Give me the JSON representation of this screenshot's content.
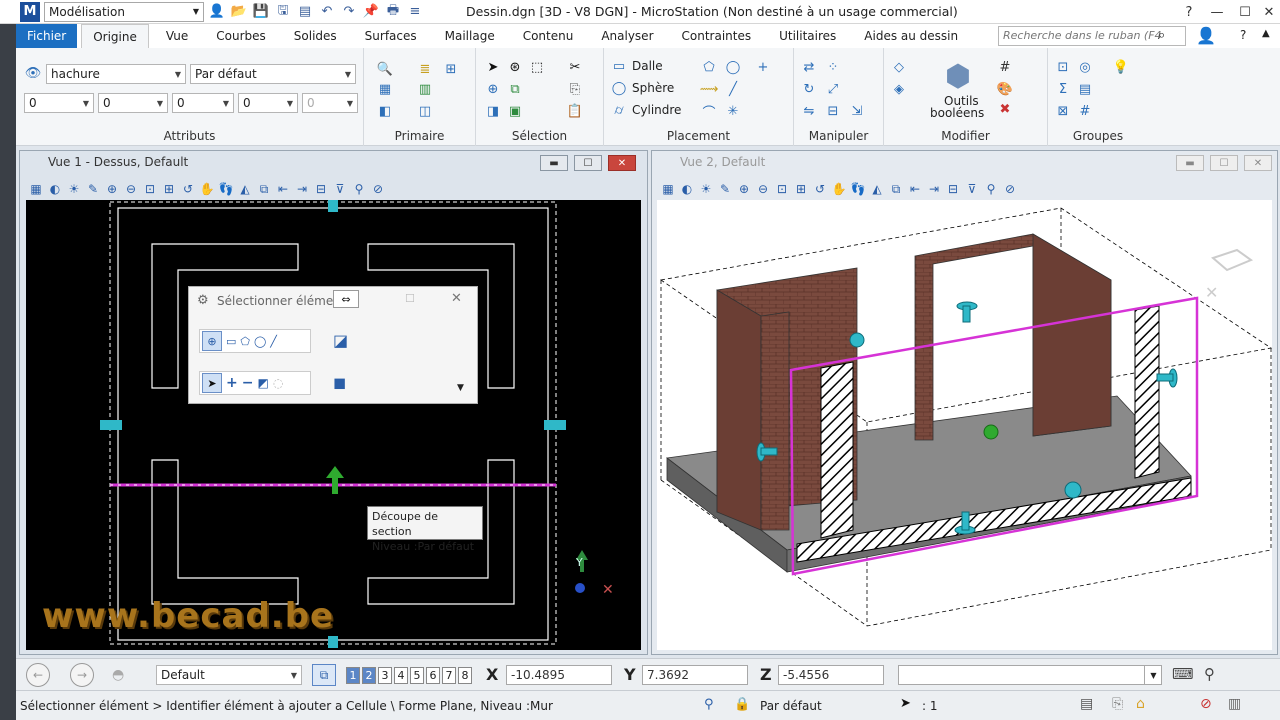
{
  "app": {
    "workspace": "Modélisation",
    "title": "Dessin.dgn [3D - V8 DGN] - MicroStation (Non destiné à un usage commercial)",
    "logo": "M"
  },
  "tabs": [
    "Fichier",
    "Origine",
    "Vue",
    "Courbes",
    "Solides",
    "Surfaces",
    "Maillage",
    "Contenu",
    "Analyser",
    "Contraintes",
    "Utilitaires",
    "Aides au dessin"
  ],
  "search": {
    "placeholder": "Recherche dans le ruban (F4"
  },
  "ribbon": {
    "attributs": {
      "label": "Attributs",
      "level": "hachure",
      "style": "Par défaut",
      "fields": [
        "0",
        "0",
        "0",
        "0",
        "0"
      ]
    },
    "primaire": {
      "label": "Primaire"
    },
    "selection": {
      "label": "Sélection"
    },
    "placement": {
      "label": "Placement",
      "items": [
        "Dalle",
        "Sphère",
        "Cylindre"
      ]
    },
    "manipuler": {
      "label": "Manipuler"
    },
    "modifier": {
      "label": "Modifier",
      "bool_label_1": "Outils",
      "bool_label_2": "booléens"
    },
    "groupes": {
      "label": "Groupes"
    }
  },
  "view1": {
    "title": "Vue 1 - Dessus, Default"
  },
  "view2": {
    "title": "Vue 2, Default"
  },
  "dialog": {
    "title": "Sélectionner élément"
  },
  "tooltip": {
    "line1": "Découpe de section",
    "line2": "Niveau :Par défaut"
  },
  "watermark": "www.becad.be",
  "bottombar": {
    "view_group": "Default",
    "view_numbers": [
      "1",
      "2",
      "3",
      "4",
      "5",
      "6",
      "7",
      "8"
    ],
    "x_label": "X",
    "x_value": "-10.4895",
    "y_label": "Y",
    "y_value": "7.3692",
    "z_label": "Z",
    "z_value": "-5.4556"
  },
  "status": {
    "prompt": "Sélectionner élément > Identifier élément à ajouter a",
    "element_info": "Cellule \\ Forme Plane, Niveau :Mur",
    "active_style": "Par défaut",
    "selection_count": ": 1"
  },
  "colors": {
    "accent": "#1c6fc2",
    "selection": "#d633d6",
    "handle": "#2fb8c8",
    "brick": "#7a4a3e"
  }
}
